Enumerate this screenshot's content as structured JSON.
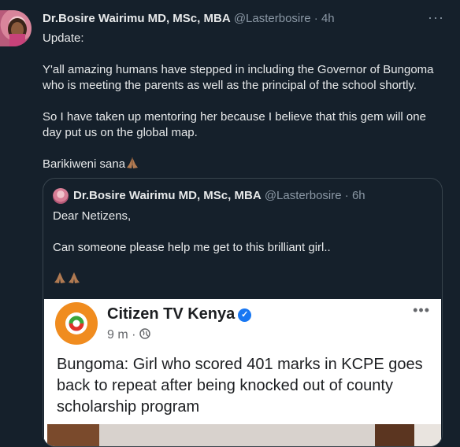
{
  "tweet": {
    "author_name": "Dr.Bosire Wairimu MD, MSc, MBA",
    "handle": "@Lasterbosire",
    "separator": "·",
    "time": "4h",
    "more": "···",
    "lines": [
      "Update:",
      "Y'all amazing humans have stepped in including the Governor of Bungoma who is meeting the parents as well as the principal of the school shortly.",
      "So I have taken up mentoring her because I believe that this gem will one day put us on the global map.",
      "Barikiweni sana"
    ]
  },
  "quote": {
    "author_name": "Dr.Bosire Wairimu MD, MSc, MBA",
    "handle": "@Lasterbosire",
    "separator": "·",
    "time": "6h",
    "lines": [
      "Dear Netizens,",
      "Can someone please help me get to this brilliant girl.."
    ],
    "media": {
      "page_name": "Citizen TV Kenya",
      "time": "9 m",
      "separator": "·",
      "more": "•••",
      "headline": "Bungoma: Girl who scored 401 marks in KCPE goes back to repeat after being knocked out of county scholarship program"
    }
  },
  "icons": {
    "pray": "folded-hands-icon",
    "verified": "verified-check-icon",
    "globe": "globe-icon"
  }
}
